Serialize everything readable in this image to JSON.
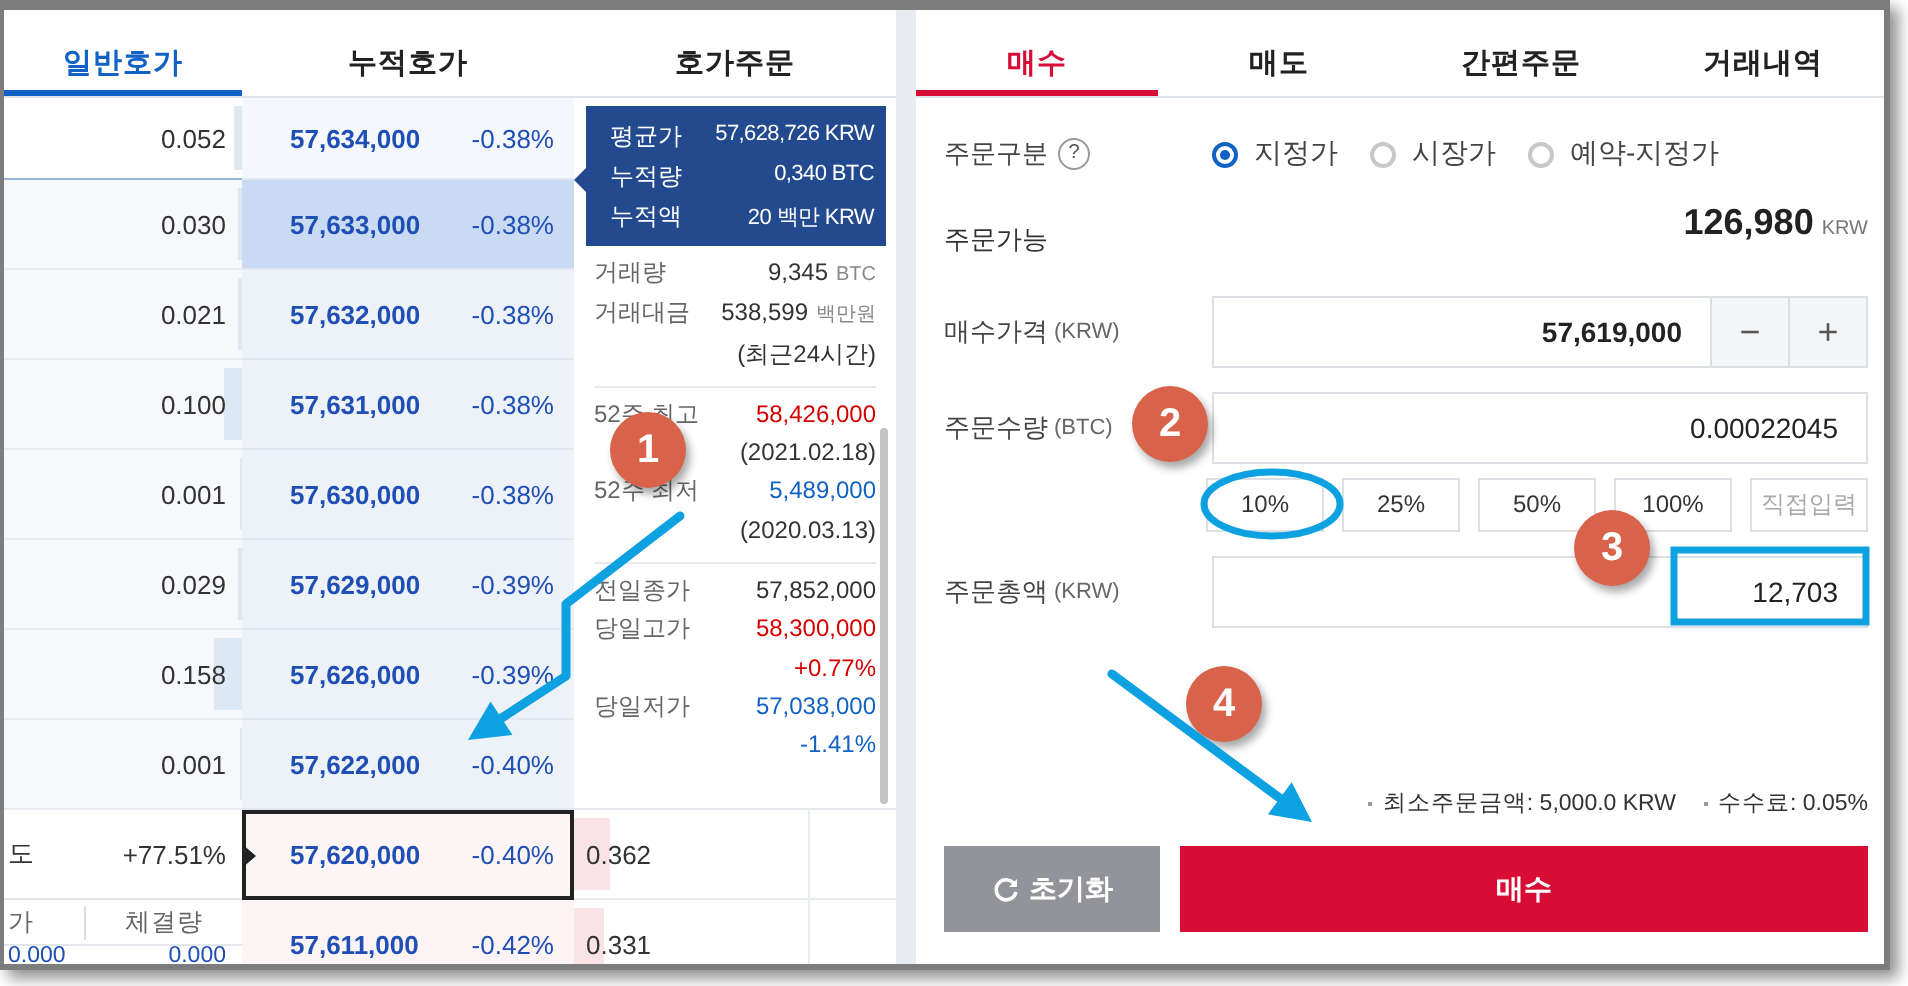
{
  "orderbook": {
    "tabs": [
      {
        "label": "일반호가",
        "selected": true
      },
      {
        "label": "누적호가",
        "selected": false
      },
      {
        "label": "호가주문",
        "selected": false
      }
    ],
    "asks": [
      {
        "quantity": "0.052",
        "level": 0.03,
        "price": "57,634,000",
        "change": "-0.38%",
        "highlighted": false
      },
      {
        "quantity": "0.030",
        "level": 0.02,
        "price": "57,633,000",
        "change": "-0.38%",
        "highlighted": true
      },
      {
        "quantity": "0.021",
        "level": 0.02,
        "price": "57,632,000",
        "change": "-0.38%",
        "highlighted": false
      },
      {
        "quantity": "0.100",
        "level": 0.08,
        "price": "57,631,000",
        "change": "-0.38%",
        "highlighted": false
      },
      {
        "quantity": "0.001",
        "level": 0.01,
        "price": "57,630,000",
        "change": "-0.38%",
        "highlighted": false
      },
      {
        "quantity": "0.029",
        "level": 0.02,
        "price": "57,629,000",
        "change": "-0.39%",
        "highlighted": false
      },
      {
        "quantity": "0.158",
        "level": 0.12,
        "price": "57,626,000",
        "change": "-0.39%",
        "highlighted": false
      },
      {
        "quantity": "0.001",
        "level": 0.01,
        "price": "57,622,000",
        "change": "-0.40%",
        "highlighted": false
      }
    ],
    "current": {
      "strength_label": "도",
      "strength": "+77.51%",
      "price": "57,620,000",
      "change": "-0.40%",
      "bid": {
        "quantity": "0.362",
        "level": 0.15
      }
    },
    "bids": [
      {
        "price": "57,611,000",
        "change": "-0.42%",
        "bid": {
          "quantity": "0.331",
          "level": 0.13
        }
      }
    ],
    "trades": {
      "columns": [
        "가",
        "체결량"
      ],
      "rows": [
        [
          "0.000",
          "0.000"
        ]
      ]
    },
    "summary_popup": [
      {
        "label": "평균가",
        "value": "57,628,726 KRW"
      },
      {
        "label": "누적량",
        "value": "0,340 BTC"
      },
      {
        "label": "누적액",
        "value": "20 백만 KRW"
      }
    ],
    "market_info": [
      [
        {
          "kind": "stat",
          "label": "거래량",
          "value": "9,345",
          "unit": "BTC",
          "color": "#333333"
        },
        {
          "kind": "stat",
          "label": "거래대금",
          "value": "538,599",
          "unit": "백만원",
          "color": "#333333"
        },
        {
          "kind": "note",
          "text": "(최근24시간)",
          "color": "#333333"
        }
      ],
      [
        {
          "kind": "stat",
          "label": "52주 최고",
          "value": "58,426,000",
          "color": "#d60000"
        },
        {
          "kind": "note",
          "text": "(2021.02.18)",
          "color": "#333333"
        },
        {
          "kind": "stat",
          "label": "52주 최저",
          "value": "5,489,000",
          "color": "#1261c4"
        },
        {
          "kind": "note",
          "text": "(2020.03.13)",
          "color": "#333333"
        }
      ],
      [
        {
          "kind": "stat",
          "label": "전일종가",
          "value": "57,852,000",
          "color": "#333333"
        },
        {
          "kind": "stat",
          "label": "당일고가",
          "value": "58,300,000",
          "color": "#d60000"
        },
        {
          "kind": "note",
          "text": "+0.77%",
          "color": "#d60000"
        },
        {
          "kind": "stat",
          "label": "당일저가",
          "value": "57,038,000",
          "color": "#1261c4"
        },
        {
          "kind": "note",
          "text": "-1.41%",
          "color": "#1261c4"
        }
      ]
    ]
  },
  "order_form": {
    "tabs": [
      {
        "label": "매수",
        "selected": true
      },
      {
        "label": "매도",
        "selected": false
      },
      {
        "label": "간편주문",
        "selected": false
      },
      {
        "label": "거래내역",
        "selected": false
      }
    ],
    "order_type": {
      "label": "주문구분",
      "help": "?",
      "options": [
        {
          "label": "지정가",
          "selected": true
        },
        {
          "label": "시장가",
          "selected": false
        },
        {
          "label": "예약-지정가",
          "selected": false
        }
      ]
    },
    "available": {
      "label": "주문가능",
      "value": "126,980",
      "unit": "KRW"
    },
    "price": {
      "label": "매수가격",
      "unit": "(KRW)",
      "value": "57,619,000",
      "decrement": "−",
      "increment": "+"
    },
    "quantity": {
      "label": "주문수량",
      "unit": "(BTC)",
      "value": "0.00022045"
    },
    "ratio_buttons": [
      {
        "label": "10%",
        "disabled": false
      },
      {
        "label": "25%",
        "disabled": false
      },
      {
        "label": "50%",
        "disabled": false
      },
      {
        "label": "100%",
        "disabled": false
      },
      {
        "label": "직접입력",
        "disabled": true
      }
    ],
    "total": {
      "label": "주문총액",
      "unit": "(KRW)",
      "value": "12,703"
    },
    "notes": [
      "최소주문금액: 5,000.0 KRW",
      "수수료: 0.05%"
    ],
    "reset_button": "초기화",
    "submit_button": "매수"
  },
  "annotations": {
    "markers": [
      {
        "label": "1"
      },
      {
        "label": "2"
      },
      {
        "label": "3"
      },
      {
        "label": "4"
      }
    ]
  }
}
